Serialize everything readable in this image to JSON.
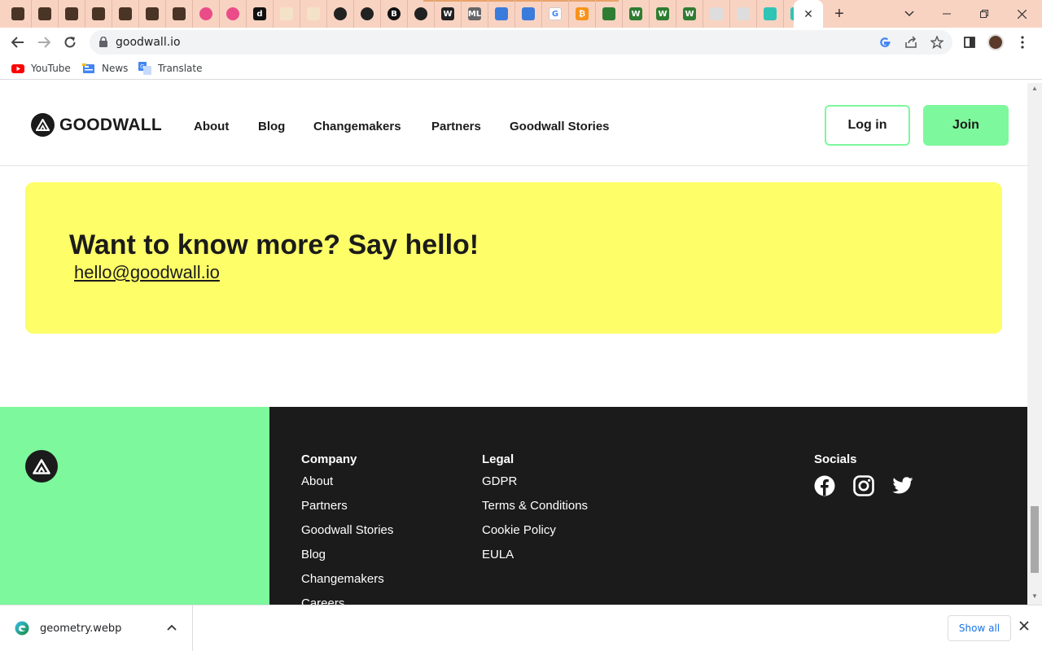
{
  "browser": {
    "url": "goodwall.io",
    "bookmarks": [
      {
        "label": "YouTube",
        "icon": "youtube-icon"
      },
      {
        "label": "News",
        "icon": "news-icon"
      },
      {
        "label": "Translate",
        "icon": "translate-icon"
      }
    ],
    "tab_favicon_glyphs": [
      "",
      "",
      "",
      "",
      "",
      "",
      "",
      "",
      "",
      "d",
      "",
      "",
      "",
      "",
      "B",
      "",
      "W",
      "ML",
      "",
      "",
      "G",
      "₿",
      "",
      "W",
      "W",
      "W",
      "",
      "",
      "",
      ""
    ],
    "colors": {
      "tabstrip": "#f9d3c2",
      "omnibox": "#f1f3f4"
    }
  },
  "site": {
    "logo_text": "GOODWALL",
    "nav": [
      "About",
      "Blog",
      "Changemakers",
      "Partners",
      "Goodwall Stories"
    ],
    "login_label": "Log in",
    "join_label": "Join",
    "colors": {
      "brand_green": "#7df89c",
      "card_yellow": "#fefe68",
      "dark": "#1b1b1b"
    }
  },
  "hello": {
    "title": "Want to know more? Say hello!",
    "email": "hello@goodwall.io"
  },
  "footer": {
    "company": {
      "heading": "Company",
      "links": [
        "About",
        "Partners",
        "Goodwall Stories",
        "Blog",
        "Changemakers",
        "Careers"
      ]
    },
    "legal": {
      "heading": "Legal",
      "links": [
        "GDPR",
        "Terms & Conditions",
        "Cookie Policy",
        "EULA"
      ]
    },
    "socials": {
      "heading": "Socials",
      "icons": [
        "facebook-icon",
        "instagram-icon",
        "twitter-icon"
      ]
    }
  },
  "download": {
    "filename": "geometry.webp",
    "show_all_label": "Show all"
  }
}
